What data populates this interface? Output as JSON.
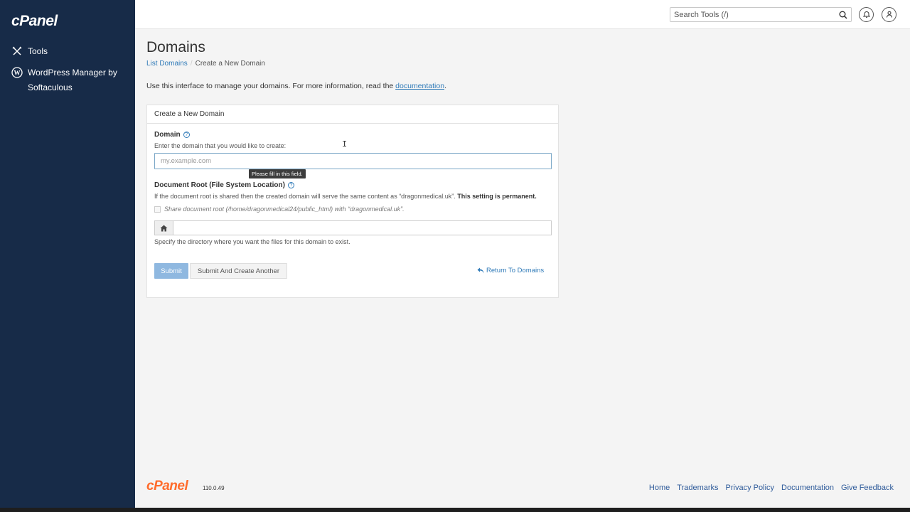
{
  "sidebar": {
    "logo": "cPanel",
    "items": [
      {
        "label": "Tools",
        "icon": "tools-icon"
      },
      {
        "label": "WordPress Manager by Softaculous",
        "icon": "wordpress-icon"
      }
    ]
  },
  "topbar": {
    "search_placeholder": "Search Tools (/)"
  },
  "page": {
    "title": "Domains",
    "breadcrumb": {
      "parent": "List Domains",
      "current": "Create a New Domain"
    },
    "intro_text": "Use this interface to manage your domains. For more information, read the ",
    "intro_link": "documentation",
    "intro_end": "."
  },
  "panel": {
    "header": "Create a New Domain",
    "domain": {
      "label": "Domain",
      "hint": "Enter the domain that you would like to create:",
      "placeholder": "my.example.com",
      "value": "",
      "tooltip": "Please fill in this field."
    },
    "docroot": {
      "label": "Document Root (File System Location)",
      "hint": "If the document root is shared then the created domain will serve the same content as “dragonmedical.uk”.",
      "hint_bold": "This setting is permanent.",
      "share_label": "Share document root (/home/dragonmedical24/public_html) with “dragonmedical.uk”.",
      "value": "",
      "specify_hint": "Specify the directory where you want the files for this domain to exist."
    },
    "submit_label": "Submit",
    "submit_another_label": "Submit And Create Another",
    "return_label": "Return To Domains"
  },
  "footer": {
    "logo": "cPanel",
    "version": "110.0.49",
    "links": [
      "Home",
      "Trademarks",
      "Privacy Policy",
      "Documentation",
      "Give Feedback"
    ]
  },
  "colors": {
    "sidebar_bg": "#172b48",
    "link": "#2f7ab8",
    "footer_logo": "#ff6c2c",
    "submit_bg": "#8fb8e0"
  }
}
